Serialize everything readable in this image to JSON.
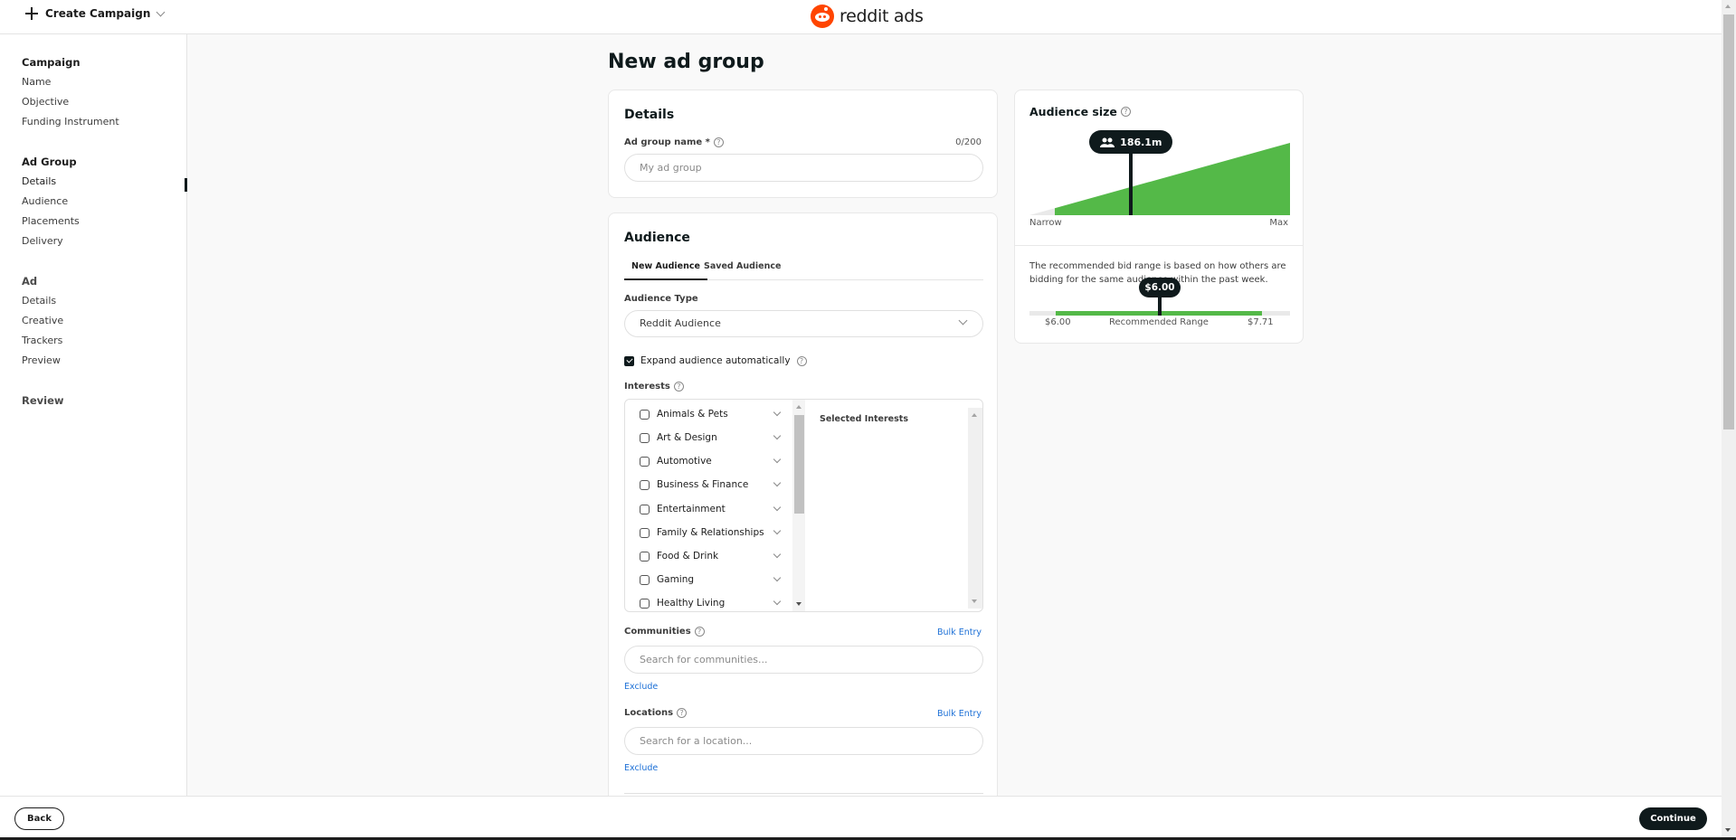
{
  "header": {
    "create_campaign_label": "Create Campaign",
    "logo_text": "reddit ads"
  },
  "sidebar": {
    "sections": [
      {
        "title": "Campaign",
        "items": [
          "Name",
          "Objective",
          "Funding Instrument"
        ]
      },
      {
        "title": "Ad Group",
        "items": [
          "Details",
          "Audience",
          "Placements",
          "Delivery"
        ],
        "active_item": "Details"
      },
      {
        "title": "Ad",
        "items": [
          "Details",
          "Creative",
          "Trackers",
          "Preview"
        ]
      },
      {
        "title": "Review",
        "items": []
      }
    ]
  },
  "main": {
    "page_title": "New ad group",
    "details": {
      "title": "Details",
      "ad_group_name_label": "Ad group name *",
      "ad_group_name_value": "",
      "ad_group_name_placeholder": "My ad group",
      "char_count": "0/200"
    },
    "audience": {
      "title": "Audience",
      "tabs": [
        {
          "label": "New Audience",
          "active": true
        },
        {
          "label": "Saved Audience",
          "active": false
        }
      ],
      "audience_type_label": "Audience Type",
      "audience_type_value": "Reddit Audience",
      "expand_label": "Expand audience automatically",
      "expand_checked": true,
      "interests_label": "Interests",
      "interests": [
        "Animals & Pets",
        "Art & Design",
        "Automotive",
        "Business & Finance",
        "Entertainment",
        "Family & Relationships",
        "Food & Drink",
        "Gaming",
        "Healthy Living"
      ],
      "selected_interests_title": "Selected Interests",
      "communities_label": "Communities",
      "communities_placeholder": "Search for communities...",
      "locations_label": "Locations",
      "locations_placeholder": "Search for a location...",
      "bulk_entry_label": "Bulk Entry",
      "exclude_label": "Exclude"
    }
  },
  "audience_size": {
    "title": "Audience size",
    "value": "186.1m",
    "marker_fraction": 0.39,
    "narrow_label": "Narrow",
    "max_label": "Max",
    "bid_text": "The recommended bid range is based on how others are bidding for the same audience within the past week.",
    "bid_value": "$6.00",
    "range_min": "$6.00",
    "range_label": "Recommended Range",
    "range_max": "$7.71",
    "colors": {
      "fill": "#54b948",
      "dark": "#0f1a1c",
      "track": "#e9e9e9"
    }
  },
  "footer": {
    "back_label": "Back",
    "continue_label": "Continue"
  }
}
